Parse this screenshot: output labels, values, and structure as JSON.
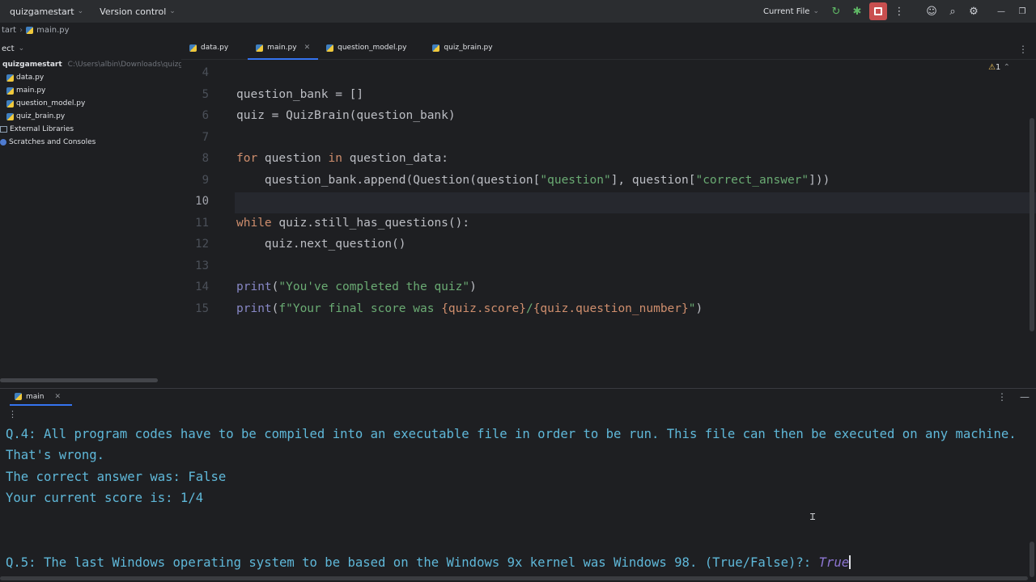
{
  "titlebar": {
    "project_name": "quizgamestart",
    "vcs": "Version control",
    "run_config": "Current File"
  },
  "breadcrumb": {
    "root": "tart",
    "file": "main.py"
  },
  "project": {
    "header": "ect",
    "root_name": "quizgamestart",
    "root_path": "C:\\Users\\albin\\Downloads\\quizgam",
    "files": [
      "data.py",
      "main.py",
      "question_model.py",
      "quiz_brain.py"
    ],
    "external": "External Libraries",
    "scratches": "Scratches and Consoles"
  },
  "tabs": [
    {
      "label": "data.py",
      "active": false
    },
    {
      "label": "main.py",
      "active": true
    },
    {
      "label": "question_model.py",
      "active": false
    },
    {
      "label": "quiz_brain.py",
      "active": false
    }
  ],
  "editor": {
    "warnings": "1",
    "line_numbers": [
      "4",
      "5",
      "6",
      "7",
      "8",
      "9",
      "10",
      "11",
      "12",
      "13",
      "14",
      "15"
    ],
    "code": {
      "l5": "question_bank = []",
      "l6": "quiz = QuizBrain(question_bank)",
      "l8_kw1": "for",
      "l8_a": " question ",
      "l8_kw2": "in",
      "l8_b": " question_data:",
      "l9_a": "    question_bank.append(Question(question[",
      "l9_s1": "\"question\"",
      "l9_b": "], question[",
      "l9_s2": "\"correct_answer\"",
      "l9_c": "]))",
      "l11_kw": "while",
      "l11_rest": " quiz.still_has_questions():",
      "l12": "    quiz.next_question()",
      "l14_fn": "print",
      "l14_a": "(",
      "l14_s": "\"You've completed the quiz\"",
      "l14_b": ")",
      "l15_fn": "print",
      "l15_a": "(",
      "l15_s1": "f\"Your final score was ",
      "l15_e1": "{quiz.score}",
      "l15_s2": "/",
      "l15_e2": "{quiz.question_number}",
      "l15_s3": "\"",
      "l15_b": ")"
    }
  },
  "run": {
    "tab_label": "main",
    "console": [
      "Q.4: All program codes have to be compiled into an executable file in order to be run. This file can then be executed on any machine.",
      "That's wrong.",
      "The correct answer was: False",
      "Your current score is: 1/4",
      "Q.5: The last Windows operating system to be based on the Windows 9x kernel was Windows 98. (True/False)?: "
    ],
    "user_input": "True"
  },
  "colors": {
    "accent": "#3574f0",
    "keyword": "#cf8e6d",
    "string": "#6aab73",
    "console_text": "#5fb8d9",
    "user_input": "#8d76d3",
    "stop": "#c94f4f"
  }
}
